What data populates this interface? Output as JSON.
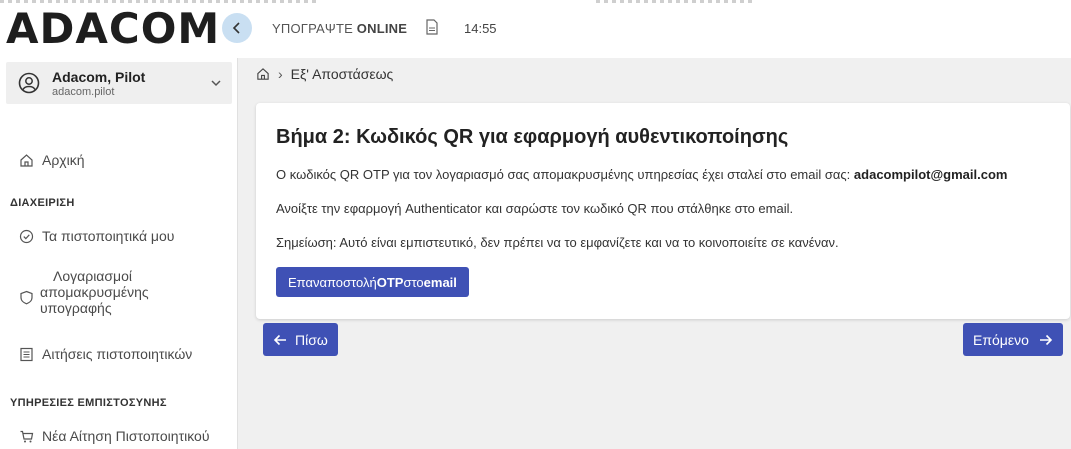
{
  "header": {
    "logo": "ADACOM",
    "sign_prefix": "ΥΠΟΓΡΑΨΤΕ",
    "sign_suffix": "ONLINE",
    "time": "14:55"
  },
  "user": {
    "name": "Adacom, Pilot",
    "login": "adacom.pilot"
  },
  "sidebar": {
    "home": "Αρχική",
    "section_admin": "ΔΙΑΧΕΙΡΙΣΗ",
    "my_certs": "Τα πιστοποιητικά μου",
    "remote_sig_line1": "Λογαριασμοί",
    "remote_sig_line2": "απομακρυσμένης",
    "remote_sig_line3": "υπογραφής",
    "cert_requests": "Αιτήσεις πιστοποιητικών",
    "section_trust": "ΥΠΗΡΕΣΙΕΣ ΕΜΠΙΣΤΟΣΥΝΗΣ",
    "new_cert_request": "Νέα Αίτηση Πιστοποιητικού"
  },
  "breadcrumb": {
    "current": "Εξ' Αποστάσεως"
  },
  "card": {
    "title": "Βήμα 2: Κωδικός QR για εφαρμογή αυθεντικοποίησης",
    "line1_text": "Ο κωδικός QR OTP για τον λογαριασμό σας απομακρυσμένης υπηρεσίας έχει σταλεί στο email σας: ",
    "line1_email": "adacompilot@gmail.com",
    "line2": "Ανοίξτε την εφαρμογή Authenticator και σαρώστε τον κωδικό QR που στάλθηκε στο email.",
    "line3": "Σημείωση: Αυτό είναι εμπιστευτικό, δεν πρέπει να το εμφανίζετε και να το κοινοποιείτε σε κανέναν.",
    "resend_prefix": "Επαναποστολή ",
    "resend_otp": "OTP",
    "resend_mid": " στο ",
    "resend_email": "email"
  },
  "nav": {
    "back": "Πίσω",
    "next": "Επόμενο"
  },
  "colors": {
    "primary": "#3f51b5",
    "collapse_bg": "#c9dff2"
  },
  "icons": [
    "chevron-left-icon",
    "document-icon",
    "user-circle-icon",
    "chevron-down-icon",
    "home-icon",
    "check-circle-icon",
    "shield-icon",
    "list-icon",
    "cart-icon",
    "arrow-left-icon",
    "arrow-right-icon"
  ]
}
